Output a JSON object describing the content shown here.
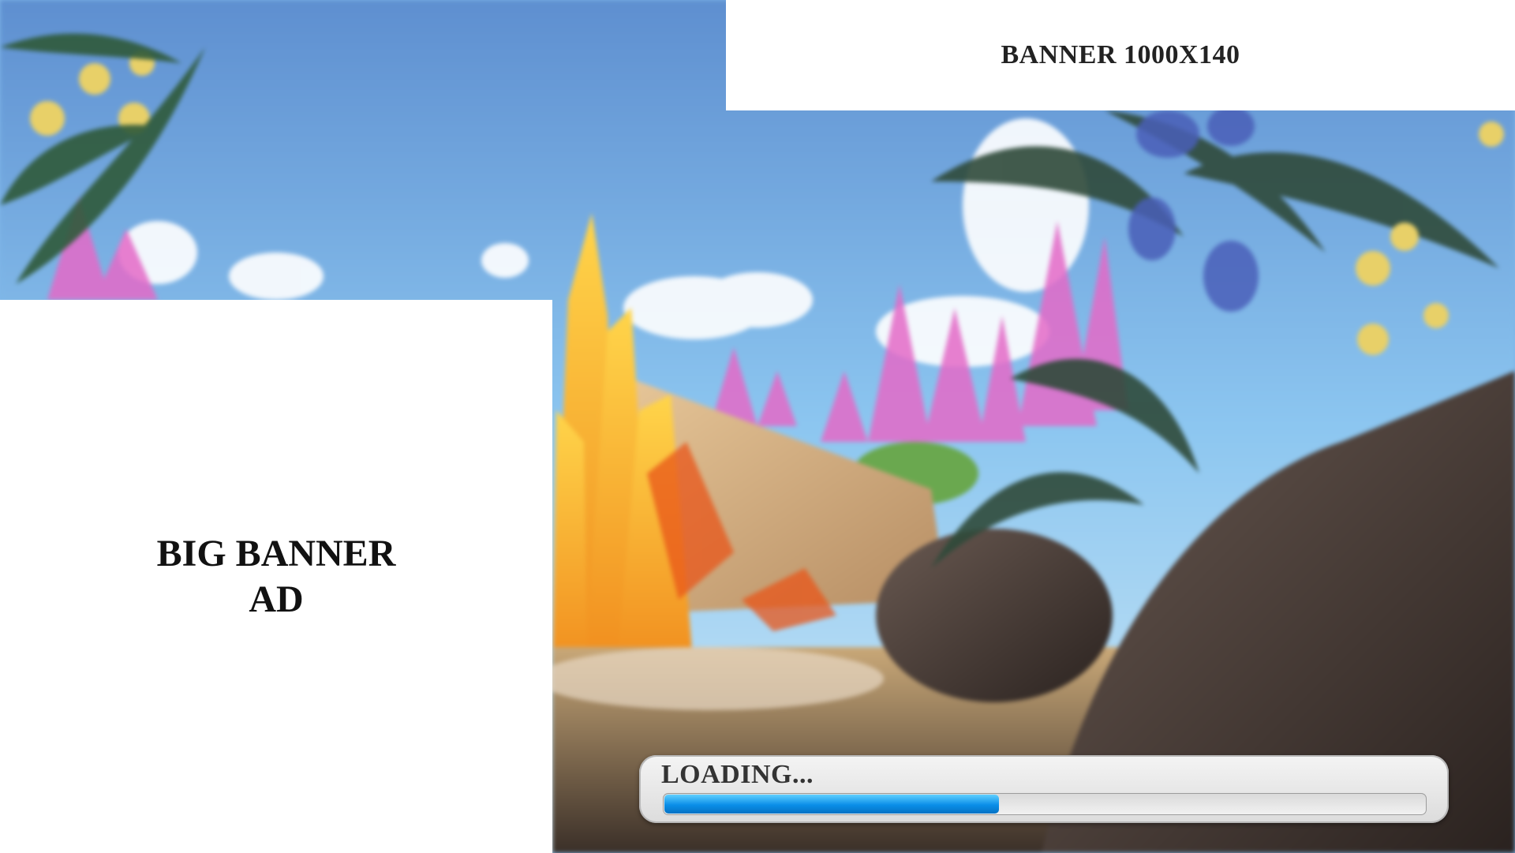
{
  "top_banner": {
    "text": "BANNER 1000X140"
  },
  "big_banner": {
    "line1": "BIG BANNER",
    "line2": "AD"
  },
  "loader": {
    "label": "LOADING...",
    "progress": 0.44
  },
  "colors": {
    "progress_fill": "#0a8ee8",
    "banner_bg": "#ffffff",
    "loader_bg": "#e8e8e8"
  }
}
